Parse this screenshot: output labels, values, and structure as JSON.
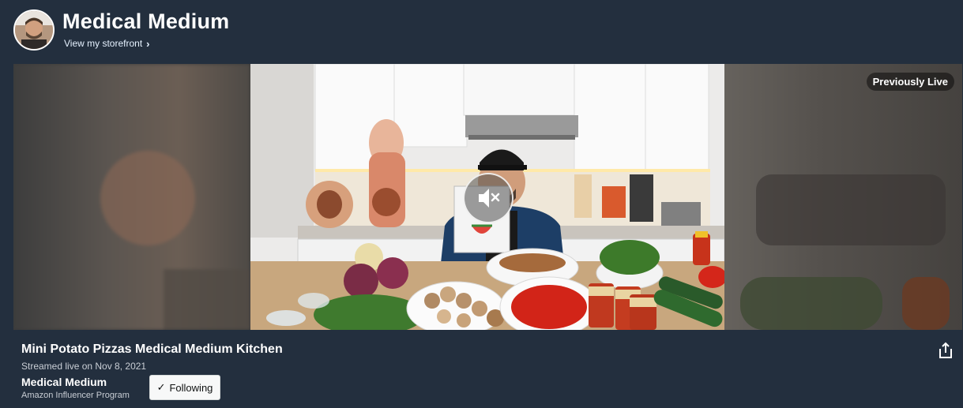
{
  "header": {
    "brand_name": "Medical Medium",
    "storefront_link": "View my storefront",
    "storefront_chevron": "›"
  },
  "player": {
    "status_badge": "Previously Live",
    "muted": true
  },
  "stream": {
    "title": "Mini Potato Pizzas Medical Medium Kitchen",
    "date_text": "Streamed live on Nov 8, 2021"
  },
  "creator": {
    "name": "Medical Medium",
    "program": "Amazon Influencer Program",
    "follow_label": "Following",
    "follow_check": "✓"
  },
  "colors": {
    "page_bg": "#232f3e",
    "button_bg": "#f7f8f8"
  }
}
